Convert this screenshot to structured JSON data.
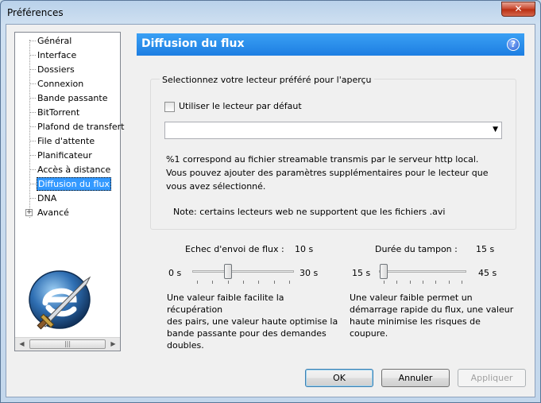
{
  "window": {
    "title": "Préférences",
    "close_symbol": "✕"
  },
  "tree": {
    "items": [
      {
        "label": "Général"
      },
      {
        "label": "Interface"
      },
      {
        "label": "Dossiers"
      },
      {
        "label": "Connexion"
      },
      {
        "label": "Bande passante"
      },
      {
        "label": "BitTorrent"
      },
      {
        "label": "Plafond de transfert"
      },
      {
        "label": "File d'attente"
      },
      {
        "label": "Planificateur"
      },
      {
        "label": "Accès à distance"
      },
      {
        "label": "Diffusion du flux",
        "selected": true
      },
      {
        "label": "DNA"
      },
      {
        "label": "Avancé",
        "expandable": true
      }
    ],
    "scroll_grip": "|||"
  },
  "panel": {
    "title": "Diffusion du flux",
    "help_symbol": "?"
  },
  "player_group": {
    "title": "Selectionnez votre lecteur préféré pour l'aperçu",
    "use_default_label": "Utiliser le lecteur par défaut",
    "use_default_checked": false,
    "player_value": "",
    "description": "%1 correspond au fichier streamable transmis par le serveur http local. Vous pouvez ajouter des paramètres supplémentaires pour le lecteur que vous avez sélectionné.",
    "note": "Note: certains lecteurs web ne supportent que les fichiers .avi"
  },
  "send_failure": {
    "label": "Echec d'envoi de flux :",
    "value": "10 s",
    "min": "0 s",
    "max": "30 s",
    "value_num": 10,
    "min_num": 0,
    "max_num": 30,
    "help": [
      "Une valeur faible facilite la récupération",
      "des pairs, une valeur haute optimise la",
      "bande passante pour des demandes",
      "doubles."
    ]
  },
  "buffer": {
    "label": "Durée du tampon :",
    "value": "15 s",
    "min": "15 s",
    "max": "45 s",
    "value_num": 15,
    "min_num": 15,
    "max_num": 45,
    "help": [
      "Une valeur faible permet un",
      "démarrage rapide du flux, une valeur",
      "haute minimise les risques de",
      "coupure."
    ]
  },
  "buttons": {
    "ok": "OK",
    "cancel": "Annuler",
    "apply": "Appliquer"
  }
}
